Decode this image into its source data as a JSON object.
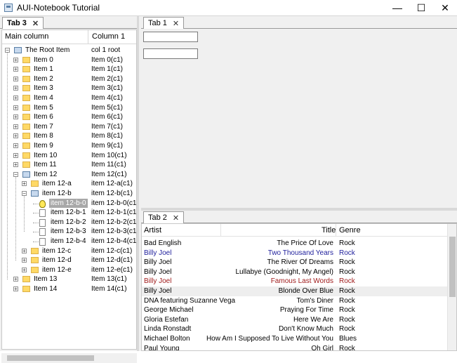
{
  "window": {
    "title": "AUI-Notebook Tutorial",
    "minimize": "—",
    "maximize": "☐",
    "close": "✕"
  },
  "left_pane": {
    "tab_label": "Tab 3",
    "tab_close": "✕",
    "columns": [
      "Main column",
      "Column 1"
    ],
    "tree": [
      {
        "label": "The Root Item",
        "value": "col 1 root",
        "depth": 0,
        "expander": "−",
        "icon": "folder-open"
      },
      {
        "label": "Item 0",
        "value": "Item 0(c1)",
        "depth": 1,
        "expander": "+",
        "icon": "folder"
      },
      {
        "label": "Item 1",
        "value": "Item 1(c1)",
        "depth": 1,
        "expander": "+",
        "icon": "folder"
      },
      {
        "label": "Item 2",
        "value": "Item 2(c1)",
        "depth": 1,
        "expander": "+",
        "icon": "folder"
      },
      {
        "label": "Item 3",
        "value": "Item 3(c1)",
        "depth": 1,
        "expander": "+",
        "icon": "folder"
      },
      {
        "label": "Item 4",
        "value": "Item 4(c1)",
        "depth": 1,
        "expander": "+",
        "icon": "folder"
      },
      {
        "label": "Item 5",
        "value": "Item 5(c1)",
        "depth": 1,
        "expander": "+",
        "icon": "folder"
      },
      {
        "label": "Item 6",
        "value": "Item 6(c1)",
        "depth": 1,
        "expander": "+",
        "icon": "folder"
      },
      {
        "label": "Item 7",
        "value": "Item 7(c1)",
        "depth": 1,
        "expander": "+",
        "icon": "folder"
      },
      {
        "label": "Item 8",
        "value": "Item 8(c1)",
        "depth": 1,
        "expander": "+",
        "icon": "folder"
      },
      {
        "label": "Item 9",
        "value": "Item 9(c1)",
        "depth": 1,
        "expander": "+",
        "icon": "folder"
      },
      {
        "label": "Item 10",
        "value": "Item 10(c1)",
        "depth": 1,
        "expander": "+",
        "icon": "folder"
      },
      {
        "label": "Item 11",
        "value": "Item 11(c1)",
        "depth": 1,
        "expander": "+",
        "icon": "folder"
      },
      {
        "label": "Item 12",
        "value": "Item 12(c1)",
        "depth": 1,
        "expander": "−",
        "icon": "folder-open"
      },
      {
        "label": "item 12-a",
        "value": "item 12-a(c1)",
        "depth": 2,
        "expander": "+",
        "icon": "folder"
      },
      {
        "label": "item 12-b",
        "value": "item 12-b(c1)",
        "depth": 2,
        "expander": "−",
        "icon": "folder-open"
      },
      {
        "label": "item 12-b-0",
        "value": "item 12-b-0(c1)",
        "depth": 3,
        "expander": "",
        "icon": "bulb",
        "selected": true
      },
      {
        "label": "item 12-b-1",
        "value": "item 12-b-1(c1)",
        "depth": 3,
        "expander": "",
        "icon": "doc"
      },
      {
        "label": "item 12-b-2",
        "value": "item 12-b-2(c1)",
        "depth": 3,
        "expander": "",
        "icon": "doc"
      },
      {
        "label": "item 12-b-3",
        "value": "item 12-b-3(c1)",
        "depth": 3,
        "expander": "",
        "icon": "doc"
      },
      {
        "label": "item 12-b-4",
        "value": "item 12-b-4(c1)",
        "depth": 3,
        "expander": "",
        "icon": "doc"
      },
      {
        "label": "item 12-c",
        "value": "item 12-c(c1)",
        "depth": 2,
        "expander": "+",
        "icon": "folder"
      },
      {
        "label": "item 12-d",
        "value": "item 12-d(c1)",
        "depth": 2,
        "expander": "+",
        "icon": "folder"
      },
      {
        "label": "item 12-e",
        "value": "item 12-e(c1)",
        "depth": 2,
        "expander": "+",
        "icon": "folder"
      },
      {
        "label": "Item 13",
        "value": "Item 13(c1)",
        "depth": 1,
        "expander": "+",
        "icon": "folder"
      },
      {
        "label": "Item 14",
        "value": "Item 14(c1)",
        "depth": 1,
        "expander": "+",
        "icon": "folder"
      }
    ]
  },
  "right_top": {
    "tab_label": "Tab 1",
    "tab_close": "✕",
    "text_fields": [
      "",
      ""
    ]
  },
  "right_bottom": {
    "tab_label": "Tab 2",
    "tab_close": "✕",
    "columns": [
      "Artist",
      "Title",
      "Genre"
    ],
    "colors": {
      "blue": "#1f1f9c",
      "red": "#a01c1c",
      "hover": "#eeeeee"
    },
    "rows": [
      {
        "artist": "Bad English",
        "title": "The Price Of Love",
        "genre": "Rock",
        "color": ""
      },
      {
        "artist": "Billy Joel",
        "title": "Two Thousand Years",
        "genre": "Rock",
        "color": "blue"
      },
      {
        "artist": "Billy Joel",
        "title": "The River Of Dreams",
        "genre": "Rock",
        "color": ""
      },
      {
        "artist": "Billy Joel",
        "title": "Lullabye (Goodnight, My Angel)",
        "genre": "Rock",
        "color": ""
      },
      {
        "artist": "Billy Joel",
        "title": "Famous Last Words",
        "genre": "Rock",
        "color": "red"
      },
      {
        "artist": "Billy Joel",
        "title": "Blonde Over Blue",
        "genre": "Rock",
        "color": "",
        "hover": true
      },
      {
        "artist": "DNA featuring Suzanne Vega",
        "title": "Tom's Diner",
        "genre": "Rock",
        "color": ""
      },
      {
        "artist": "George Michael",
        "title": "Praying For Time",
        "genre": "Rock",
        "color": ""
      },
      {
        "artist": "Gloria Estefan",
        "title": "Here We Are",
        "genre": "Rock",
        "color": ""
      },
      {
        "artist": "Linda Ronstadt",
        "title": "Don't Know Much",
        "genre": "Rock",
        "color": ""
      },
      {
        "artist": "Michael Bolton",
        "title": "How Am I Supposed To Live Without You",
        "genre": "Blues",
        "color": ""
      },
      {
        "artist": "Paul Young",
        "title": "Oh Girl",
        "genre": "Rock",
        "color": ""
      }
    ]
  }
}
